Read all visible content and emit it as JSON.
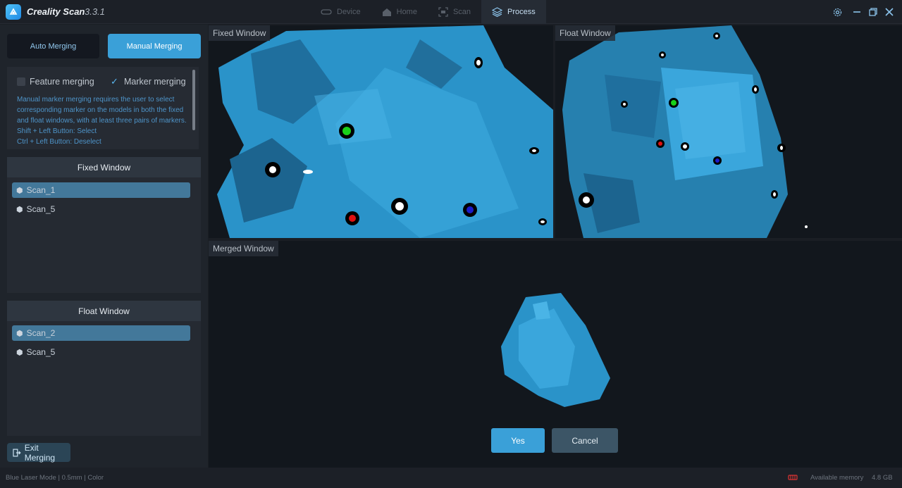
{
  "app": {
    "name": "Creality Scan",
    "version": "3.3.1"
  },
  "nav": {
    "tabs": [
      {
        "label": "Device",
        "icon": "device-icon",
        "active": false
      },
      {
        "label": "Home",
        "icon": "home-icon",
        "active": false
      },
      {
        "label": "Scan",
        "icon": "scan-icon",
        "active": false
      },
      {
        "label": "Process",
        "icon": "layers-icon",
        "active": true
      }
    ]
  },
  "window_controls": {
    "settings": "gear-icon",
    "minimize": "minimize-icon",
    "restore": "restore-icon",
    "close": "close-icon"
  },
  "merging": {
    "auto_label": "Auto Merging",
    "manual_label": "Manual Merging",
    "feature_merging": {
      "label": "Feature merging",
      "checked": false
    },
    "marker_merging": {
      "label": "Marker merging",
      "checked": true
    },
    "description": "Manual marker merging requires the user to select corresponding marker on the models in both the fixed and float windows, with at least three pairs of markers.",
    "hint_1": "Shift + Left Button: Select",
    "hint_2": "Ctrl + Left Button: Deselect"
  },
  "fixed_panel": {
    "title": "Fixed Window",
    "items": [
      {
        "label": "Scan_1",
        "selected": true
      },
      {
        "label": "Scan_5",
        "selected": false
      }
    ]
  },
  "float_panel": {
    "title": "Float Window",
    "items": [
      {
        "label": "Scan_2",
        "selected": true
      },
      {
        "label": "Scan_5",
        "selected": false
      }
    ]
  },
  "exit_label": "Exit Merging",
  "views": {
    "fixed": "Fixed Window",
    "float": "Float Window",
    "merged": "Merged Window"
  },
  "actions": {
    "yes": "Yes",
    "cancel": "Cancel"
  },
  "status": {
    "mode": "Blue Laser Mode | 0.5mm | Color",
    "memory_label": "Available memory",
    "memory_value": "4.8 GB"
  },
  "colors": {
    "accent": "#3aa0d8",
    "scan_mesh": "#2a93c9",
    "marker_green": "#19d019",
    "marker_red": "#e01010",
    "marker_blue": "#1c1cc8"
  }
}
